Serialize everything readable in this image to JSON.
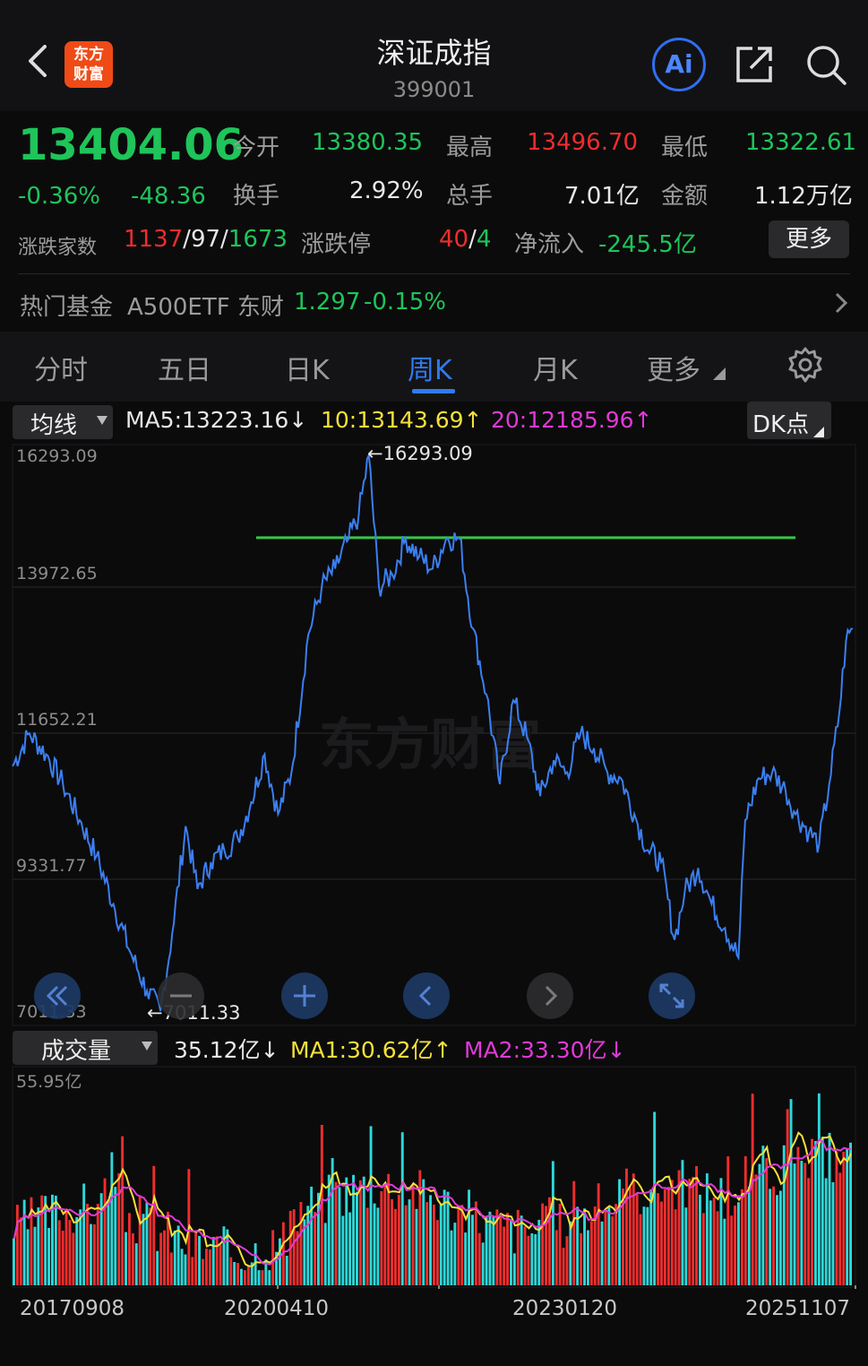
{
  "header": {
    "logo_line1": "东方",
    "logo_line2": "财富",
    "title": "深证成指",
    "code": "399001",
    "ai_label": "Ai"
  },
  "quote": {
    "price": "13404.06",
    "change_pct": "-0.36%",
    "change": "-48.36",
    "open_label": "今开",
    "open": "13380.35",
    "high_label": "最高",
    "high": "13496.70",
    "low_label": "最低",
    "low": "13322.61",
    "turnover_label": "换手",
    "turnover": "2.92%",
    "volume_label": "总手",
    "volume": "7.01亿",
    "amount_label": "金额",
    "amount": "1.12万亿",
    "breadth_label": "涨跌家数",
    "breadth_up": "1137",
    "breadth_flat": "97",
    "breadth_down": "1673",
    "limit_label": "涨跌停",
    "limit_up": "40",
    "limit_down": "4",
    "inflow_label": "净流入",
    "inflow": "-245.5亿",
    "more_label": "更多"
  },
  "fund": {
    "label": "热门基金",
    "name": "A500ETF 东财",
    "price": "1.297",
    "change": "-0.15%"
  },
  "tabs": [
    "分时",
    "五日",
    "日K",
    "周K",
    "月K",
    "更多"
  ],
  "active_tab": "周K",
  "ma": {
    "selector": "均线",
    "ma5": "MA5:13223.16↓",
    "ma10": "10:13143.69↑",
    "ma20": "20:12185.96↑",
    "dk_label": "DK点"
  },
  "price_axis": [
    "16293.09",
    "13972.65",
    "11652.21",
    "9331.77",
    "7011.33"
  ],
  "annotations": {
    "high": "←16293.09",
    "low": "←7011.33"
  },
  "volume": {
    "selector": "成交量",
    "current": "35.12亿↓",
    "ma1": "MA1:30.62亿↑",
    "ma2": "MA2:33.30亿↓",
    "axis_max": "55.95亿"
  },
  "dates": [
    "20170908",
    "20200410",
    "20230120",
    "20251107"
  ],
  "colors": {
    "up": "#ef2d2d",
    "down": "#1fc45a",
    "line": "#3b7ff0",
    "ma10": "#f5e03a",
    "ma20": "#e03ad6",
    "vol_up": "#ef2d2d",
    "vol_down": "#2ed8d8",
    "hline": "#39c24a"
  },
  "chart_data": {
    "type": "line",
    "x_start": "20170908",
    "x_end": "20251107",
    "y_range": [
      7011.33,
      16293.09
    ],
    "keypoints": [
      {
        "i": 0,
        "v": 11100
      },
      {
        "i": 10,
        "v": 11650
      },
      {
        "i": 20,
        "v": 11300
      },
      {
        "i": 30,
        "v": 10800
      },
      {
        "i": 40,
        "v": 10200
      },
      {
        "i": 50,
        "v": 9600
      },
      {
        "i": 60,
        "v": 8800
      },
      {
        "i": 70,
        "v": 8000
      },
      {
        "i": 80,
        "v": 7350
      },
      {
        "i": 88,
        "v": 7011.33
      },
      {
        "i": 95,
        "v": 8300
      },
      {
        "i": 103,
        "v": 10100
      },
      {
        "i": 110,
        "v": 9050
      },
      {
        "i": 118,
        "v": 9500
      },
      {
        "i": 126,
        "v": 9700
      },
      {
        "i": 134,
        "v": 9900
      },
      {
        "i": 142,
        "v": 10500
      },
      {
        "i": 150,
        "v": 11300
      },
      {
        "i": 158,
        "v": 10300
      },
      {
        "i": 166,
        "v": 11000
      },
      {
        "i": 176,
        "v": 13300
      },
      {
        "i": 184,
        "v": 14100
      },
      {
        "i": 192,
        "v": 14400
      },
      {
        "i": 200,
        "v": 14900
      },
      {
        "i": 206,
        "v": 15300
      },
      {
        "i": 212,
        "v": 16293.09
      },
      {
        "i": 218,
        "v": 14100
      },
      {
        "i": 226,
        "v": 14300
      },
      {
        "i": 234,
        "v": 14900
      },
      {
        "i": 242,
        "v": 14600
      },
      {
        "i": 250,
        "v": 14400
      },
      {
        "i": 258,
        "v": 14900
      },
      {
        "i": 266,
        "v": 14900
      },
      {
        "i": 274,
        "v": 13400
      },
      {
        "i": 282,
        "v": 12300
      },
      {
        "i": 290,
        "v": 10800
      },
      {
        "i": 298,
        "v": 12200
      },
      {
        "i": 306,
        "v": 11600
      },
      {
        "i": 314,
        "v": 10600
      },
      {
        "i": 322,
        "v": 11200
      },
      {
        "i": 330,
        "v": 11000
      },
      {
        "i": 338,
        "v": 11650
      },
      {
        "i": 346,
        "v": 11400
      },
      {
        "i": 354,
        "v": 11000
      },
      {
        "i": 362,
        "v": 10900
      },
      {
        "i": 370,
        "v": 10300
      },
      {
        "i": 378,
        "v": 9700
      },
      {
        "i": 386,
        "v": 9500
      },
      {
        "i": 394,
        "v": 8200
      },
      {
        "i": 400,
        "v": 9000
      },
      {
        "i": 408,
        "v": 9400
      },
      {
        "i": 416,
        "v": 8800
      },
      {
        "i": 424,
        "v": 8400
      },
      {
        "i": 432,
        "v": 7900
      },
      {
        "i": 436,
        "v": 10200
      },
      {
        "i": 444,
        "v": 10900
      },
      {
        "i": 452,
        "v": 11000
      },
      {
        "i": 460,
        "v": 10700
      },
      {
        "i": 466,
        "v": 10300
      },
      {
        "i": 474,
        "v": 10000
      },
      {
        "i": 480,
        "v": 9800
      },
      {
        "i": 486,
        "v": 10800
      },
      {
        "i": 492,
        "v": 12000
      },
      {
        "i": 496,
        "v": 13200
      },
      {
        "i": 500,
        "v": 13404.06
      }
    ],
    "hline_value": 14917,
    "volume_max": 55.95
  }
}
